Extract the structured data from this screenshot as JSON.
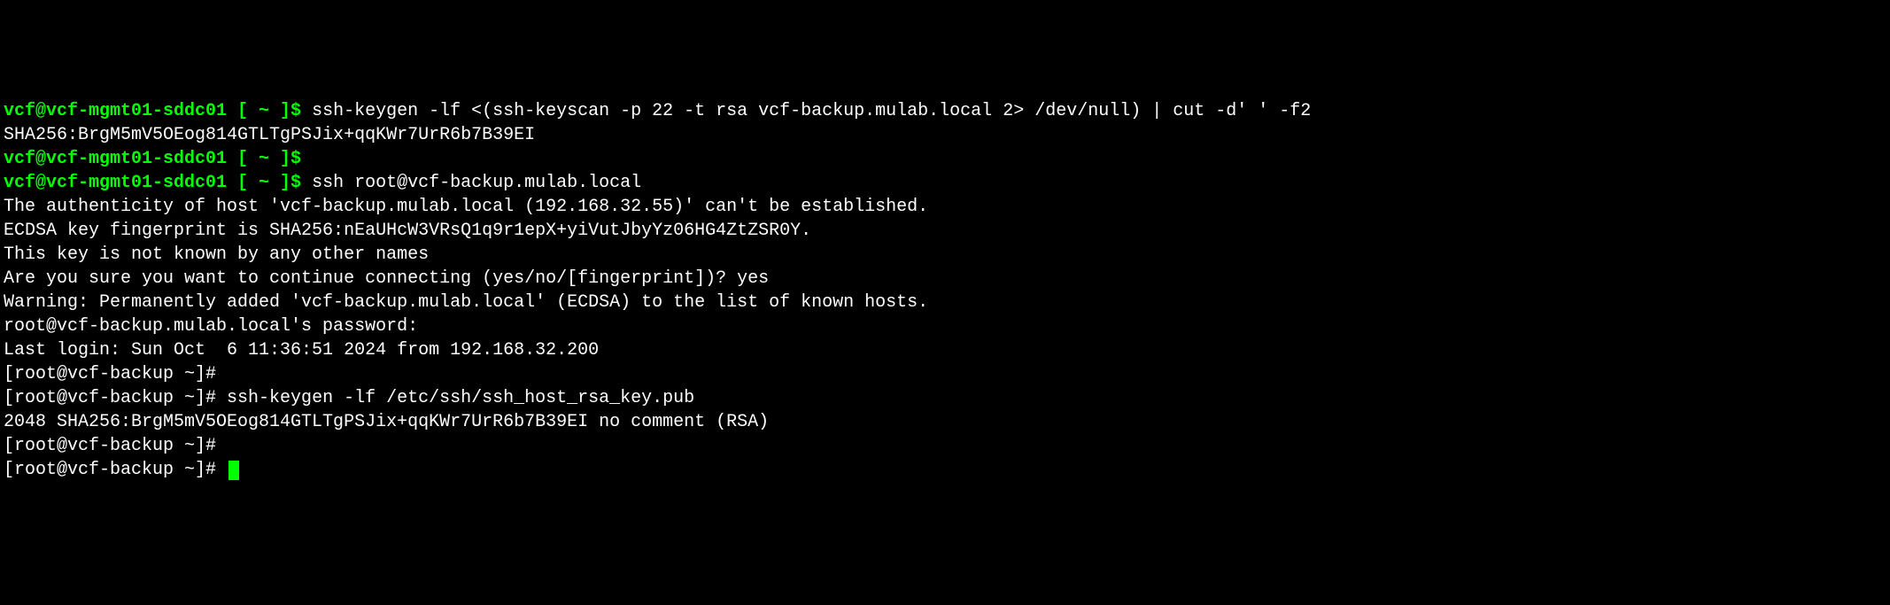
{
  "lines": [
    {
      "type": "prompt-cmd",
      "user": "vcf@vcf-mgmt01-sddc01",
      "path": "~",
      "command": "ssh-keygen -lf <(ssh-keyscan -p 22 -t rsa vcf-backup.mulab.local 2> /dev/null) | cut -d' ' -f2"
    },
    {
      "type": "output",
      "text": "SHA256:BrgM5mV5OEog814GTLTgPSJix+qqKWr7UrR6b7B39EI"
    },
    {
      "type": "prompt-cmd",
      "user": "vcf@vcf-mgmt01-sddc01",
      "path": "~",
      "command": ""
    },
    {
      "type": "prompt-cmd",
      "user": "vcf@vcf-mgmt01-sddc01",
      "path": "~",
      "command": "ssh root@vcf-backup.mulab.local"
    },
    {
      "type": "output",
      "text": "The authenticity of host 'vcf-backup.mulab.local (192.168.32.55)' can't be established."
    },
    {
      "type": "output",
      "text": "ECDSA key fingerprint is SHA256:nEaUHcW3VRsQ1q9r1epX+yiVutJbyYz06HG4ZtZSR0Y."
    },
    {
      "type": "output",
      "text": "This key is not known by any other names"
    },
    {
      "type": "output",
      "text": "Are you sure you want to continue connecting (yes/no/[fingerprint])? yes"
    },
    {
      "type": "output",
      "text": "Warning: Permanently added 'vcf-backup.mulab.local' (ECDSA) to the list of known hosts."
    },
    {
      "type": "output",
      "text": "root@vcf-backup.mulab.local's password:"
    },
    {
      "type": "output",
      "text": "Last login: Sun Oct  6 11:36:51 2024 from 192.168.32.200"
    },
    {
      "type": "root-prompt",
      "prefix": "[root@vcf-backup ~]#",
      "command": ""
    },
    {
      "type": "root-prompt",
      "prefix": "[root@vcf-backup ~]#",
      "command": "ssh-keygen -lf /etc/ssh/ssh_host_rsa_key.pub"
    },
    {
      "type": "output",
      "text": "2048 SHA256:BrgM5mV5OEog814GTLTgPSJix+qqKWr7UrR6b7B39EI no comment (RSA)"
    },
    {
      "type": "root-prompt",
      "prefix": "[root@vcf-backup ~]#",
      "command": ""
    },
    {
      "type": "root-prompt-cursor",
      "prefix": "[root@vcf-backup ~]#",
      "command": ""
    }
  ]
}
